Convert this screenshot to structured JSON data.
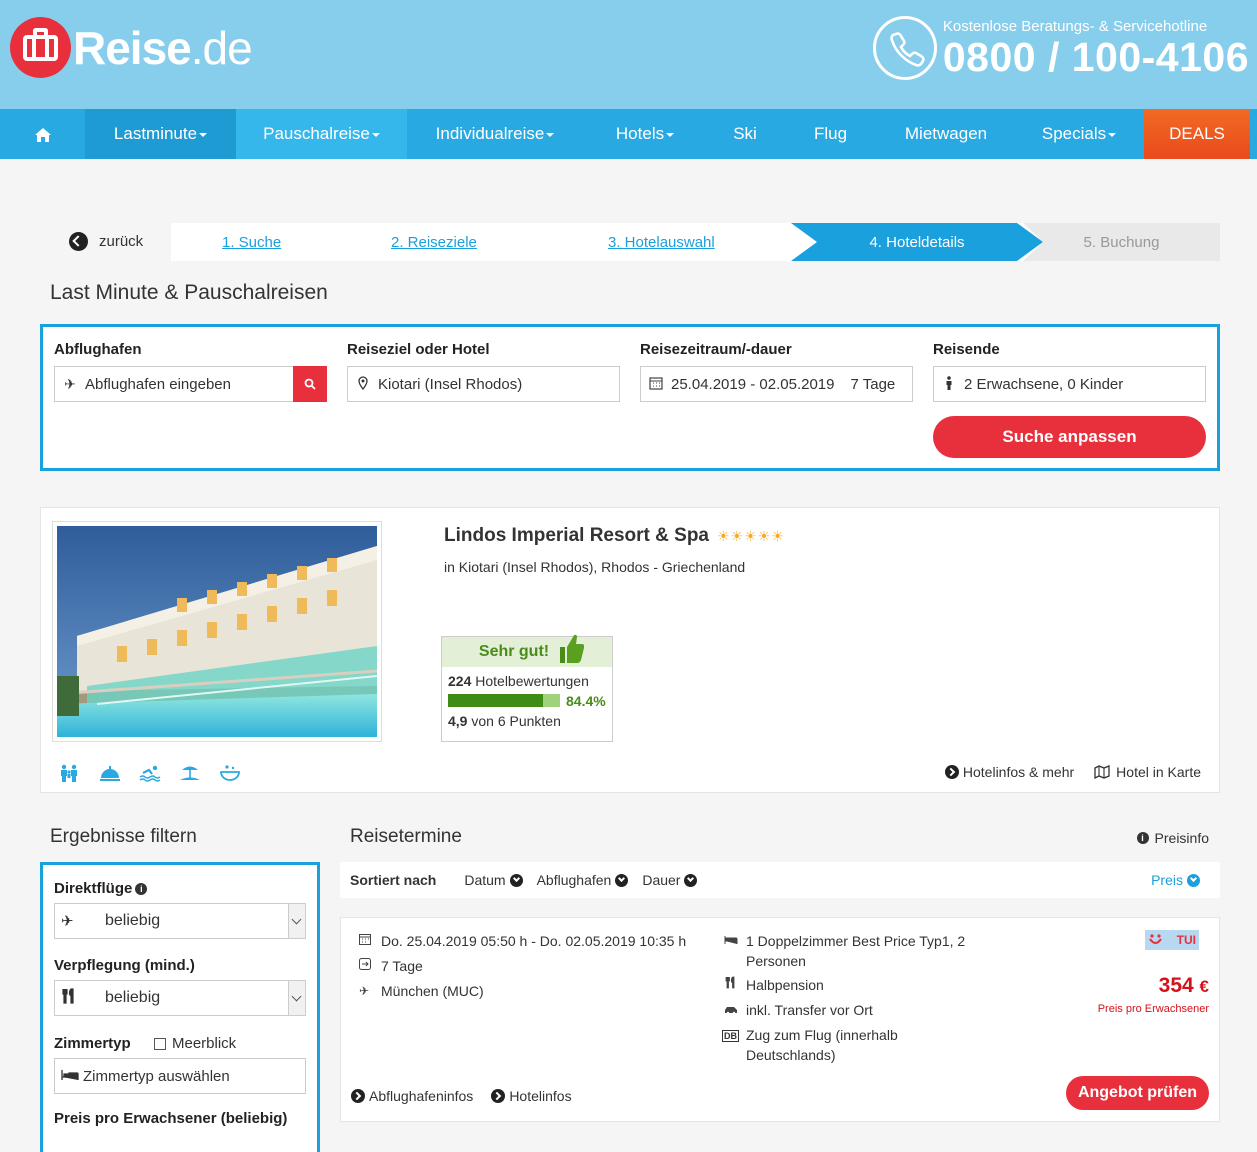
{
  "header": {
    "logo_name": "Reise",
    "logo_tld": ".de",
    "hotline_label": "Kostenlose Beratungs- & Servicehotline",
    "hotline_number": "0800 / 100-4106"
  },
  "nav": {
    "items": [
      {
        "label": "Lastminute",
        "has_caret": true
      },
      {
        "label": "Pauschalreise",
        "has_caret": true
      },
      {
        "label": "Individualreise",
        "has_caret": true
      },
      {
        "label": "Hotels",
        "has_caret": true
      },
      {
        "label": "Ski",
        "has_caret": false
      },
      {
        "label": "Flug",
        "has_caret": false
      },
      {
        "label": "Mietwagen",
        "has_caret": false
      },
      {
        "label": "Specials",
        "has_caret": true
      },
      {
        "label": "DEALS",
        "has_caret": false
      }
    ]
  },
  "breadcrumb": {
    "back_label": "zurück",
    "steps": [
      "1. Suche",
      "2. Reiseziele",
      "3. Hotelauswahl",
      "4. Hoteldetails",
      "5. Buchung"
    ]
  },
  "search": {
    "section_title": "Last Minute & Pauschalreisen",
    "abflughafen_label": "Abflughafen",
    "abflughafen_placeholder": "Abflughafen eingeben",
    "reiseziel_label": "Reiseziel oder Hotel",
    "reiseziel_value": "Kiotari (Insel Rhodos)",
    "zeitraum_label": "Reisezeitraum/-dauer",
    "zeitraum_value": "25.04.2019 - 02.05.2019",
    "dauer_value": "7 Tage",
    "reisende_label": "Reisende",
    "reisende_value": "2 Erwachsene, 0 Kinder",
    "submit_label": "Suche anpassen"
  },
  "hotel": {
    "name": "Lindos Imperial Resort & Spa",
    "stars": 5,
    "location": "in Kiotari (Insel Rhodos), Rhodos - Griechenland",
    "rating_label": "Sehr gut!",
    "review_count": "224",
    "review_label": "Hotelbewertungen",
    "recommend_pct": 84.4,
    "recommend_text": "84.4%",
    "score": "4,9",
    "score_suffix": "von 6 Punkten",
    "amenity_icons": [
      "family-icon",
      "service-bell-icon",
      "swimming-icon",
      "beach-icon",
      "spa-icon"
    ],
    "links": [
      "Hotelinfos & mehr",
      "Hotel in Karte"
    ]
  },
  "filter": {
    "title": "Ergebnisse filtern",
    "direktfluege_label": "Direktflüge",
    "direktfluege_value": "beliebig",
    "verpflegung_label": "Verpflegung (mind.)",
    "verpflegung_value": "beliebig",
    "zimmertyp_label": "Zimmertyp",
    "meerblick_label": "Meerblick",
    "zimmertyp_placeholder": "Zimmertyp auswählen",
    "preis_label": "Preis pro Erwachsener (beliebig)"
  },
  "results": {
    "title": "Reisetermine",
    "preisinfo_label": "Preisinfo",
    "sort_label": "Sortiert nach",
    "sort_options": [
      "Datum",
      "Abflughafen",
      "Dauer"
    ],
    "sort_active": "Preis",
    "offers": [
      {
        "dates": "Do. 25.04.2019 05:50 h - Do. 02.05.2019 10:35 h",
        "duration": "7 Tage",
        "airport": "München (MUC)",
        "room": "1 Doppelzimmer Best Price Typ1, 2 Personen",
        "board": "Halbpension",
        "transfer": "inkl. Transfer vor Ort",
        "rail": "Zug zum Flug (innerhalb Deutschlands)",
        "operator": "TUI",
        "price": "354",
        "currency": "€",
        "price_note": "Preis pro Erwachsener",
        "cta_label": "Angebot prüfen",
        "links": [
          "Abflughafeninfos",
          "Hotelinfos"
        ]
      }
    ]
  }
}
